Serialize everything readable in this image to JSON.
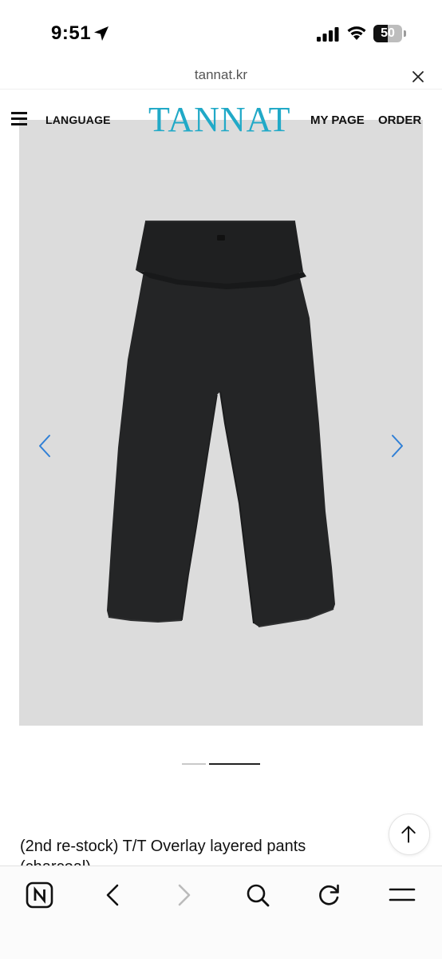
{
  "status_bar": {
    "time": "9:51",
    "battery_level": "50",
    "battery_fraction": 0.5,
    "icons": [
      "location-arrow-icon",
      "cellular-signal-icon",
      "wifi-icon",
      "battery-icon"
    ]
  },
  "browser": {
    "url": "tannat.kr",
    "close_icon": "close-icon"
  },
  "site_header": {
    "menu_icon": "hamburger-menu-icon",
    "language_label": "LANGUAGE",
    "logo_text": "TANNAT",
    "logo_color": "#21a9c7",
    "my_page_label": "MY PAGE",
    "order_label": "ORDER"
  },
  "gallery": {
    "background_color": "#dcdcdc",
    "arrow_color": "#2f7fd6",
    "prev_icon": "chevron-left-icon",
    "next_icon": "chevron-right-icon",
    "slide_count": 2,
    "active_slide": 2
  },
  "product": {
    "title_line1": "(2nd re-stock) T/T Overlay layered pants",
    "title_line2": "(charcoal)"
  },
  "scroll_top": {
    "icon": "arrow-up-icon"
  },
  "toolbar": {
    "items": [
      "naver-n-icon",
      "back-arrow-icon",
      "forward-arrow-icon",
      "search-icon",
      "reload-icon",
      "menu-lines-icon"
    ]
  }
}
